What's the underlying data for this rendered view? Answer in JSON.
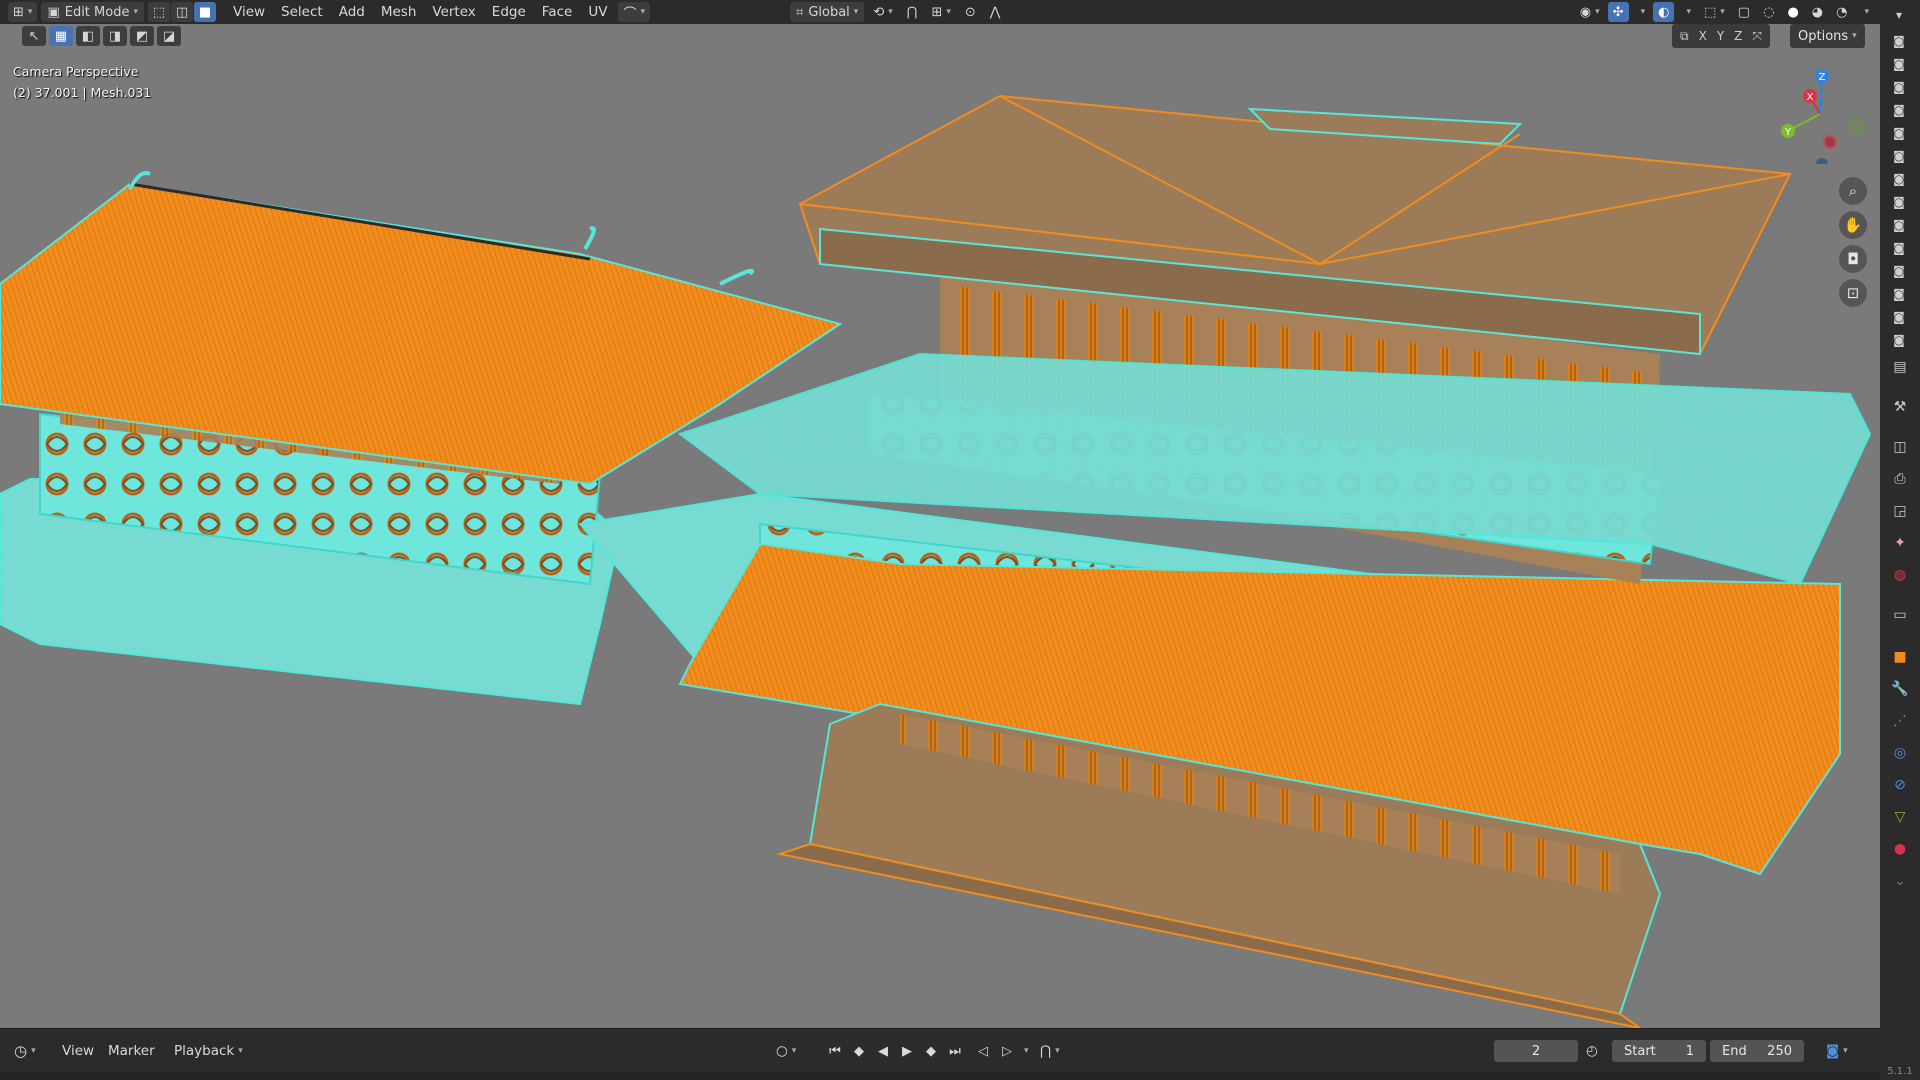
{
  "header": {
    "mode_label": "Edit Mode",
    "menus": [
      "View",
      "Select",
      "Add",
      "Mesh",
      "Vertex",
      "Edge",
      "Face",
      "UV"
    ],
    "transform_orientation": "Global"
  },
  "viewport": {
    "camera_label": "Camera Perspective",
    "object_info": "(2) 37.001 | Mesh.031",
    "axis_x": "X",
    "axis_y": "Y",
    "axis_z": "Z",
    "options_label": "Options",
    "gizmo": {
      "x": "X",
      "y": "Y",
      "z": "Z"
    }
  },
  "timeline": {
    "view_label": "View",
    "marker_label": "Marker",
    "playback_label": "Playback",
    "current_frame": "2",
    "start_label": "Start",
    "start_value": "1",
    "end_label": "End",
    "end_value": "250"
  },
  "version": "5.1.1",
  "colors": {
    "viewport_bg": "#7a7a7a",
    "selected_face": "#f28c1c",
    "wire": "#74f0e6",
    "unselected_face": "#9c7b59",
    "header_bg": "#2b2b2b",
    "active_blue": "#4772b3"
  }
}
